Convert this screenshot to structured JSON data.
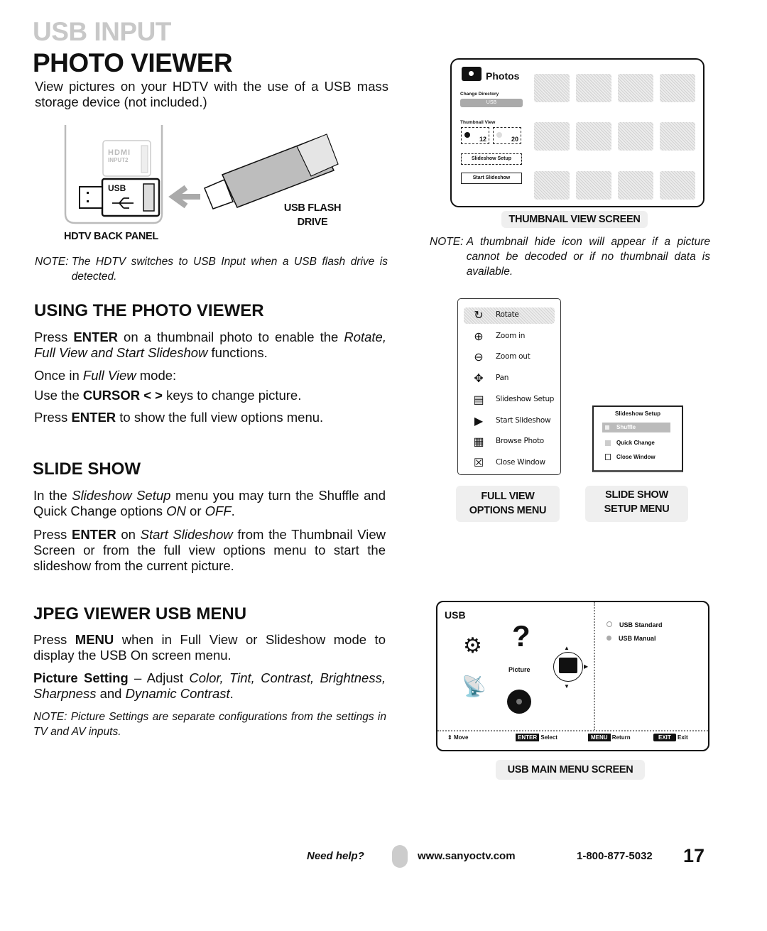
{
  "header": {
    "section_label": "USB INPUT",
    "page_title": "PHOTO VIEWER",
    "intro": "View pictures on your HDTV with the use of a USB mass storage device (not included.)"
  },
  "back_panel_figure": {
    "hdmi_label": "HDMI",
    "hdmi_input": "INPUT2",
    "usb_port_label": "USB",
    "panel_caption": "HDTV BACK PANEL",
    "drive_caption_line1": "USB FLASH",
    "drive_caption_line2": "DRIVE"
  },
  "note_detect": {
    "label": "NOTE",
    "text": "The HDTV switches to USB Input when a USB flash drive is detected."
  },
  "using": {
    "heading": "USING THE PHOTO VIEWER",
    "p1_a": "Press ",
    "p1_b": "ENTER",
    "p1_c": " on a thumbnail photo to enable the ",
    "p1_d": "Rotate, Full View and Start Slideshow",
    "p1_e": " functions.",
    "p2_a": "Once in ",
    "p2_b": "Full View",
    "p2_c": " mode:",
    "p3_a": "Use the ",
    "p3_b": "CURSOR < >",
    "p3_c": " keys to change picture.",
    "p4_a": "Press ",
    "p4_b": "ENTER",
    "p4_c": " to show the full view options menu."
  },
  "slideshow": {
    "heading": "SLIDE SHOW",
    "p1_a": "In the ",
    "p1_b": "Slideshow Setup",
    "p1_c": " menu you may turn the Shuffle and Quick Change options ",
    "p1_d": "ON",
    "p1_e": " or ",
    "p1_f": "OFF",
    "p1_g": ".",
    "p2_a": "Press ",
    "p2_b": "ENTER",
    "p2_c": " on ",
    "p2_d": "Start Slideshow",
    "p2_e": " from the Thumbnail View Screen or from the full view options menu to start the slideshow from the current picture."
  },
  "jpeg": {
    "heading": "JPEG VIEWER USB MENU",
    "p1_a": "Press ",
    "p1_b": "MENU",
    "p1_c": " when in Full View or Slideshow mode to display the USB On screen menu.",
    "p2_a": "Picture Setting",
    "p2_b": " – Adjust ",
    "p2_c": "Color, Tint, Contrast, Brightness, Sharpness",
    "p2_d": " and ",
    "p2_e": "Dynamic Contrast",
    "p2_f": ".",
    "note_label": "NOTE",
    "note_text": "Picture Settings are separate configurations from the settings in TV and AV inputs."
  },
  "thumbnail_screen": {
    "title": "Photos",
    "change_directory": "Change Directory",
    "directory_value": "USB",
    "thumbnail_view": "Thumbnail View",
    "view_12": "12",
    "view_20": "20",
    "slideshow_setup": "Slideshow Setup",
    "start_slideshow": "Start Slideshow",
    "caption": "THUMBNAIL VIEW SCREEN"
  },
  "note_thumb": {
    "label": "NOTE",
    "text": "A thumbnail hide icon will appear if a picture cannot be decoded or if no thumbnail data is available."
  },
  "fullview_menu": {
    "items": [
      {
        "icon": "rotate-icon",
        "label": "Rotate"
      },
      {
        "icon": "zoom-in-icon",
        "label": "Zoom in"
      },
      {
        "icon": "zoom-out-icon",
        "label": "Zoom out"
      },
      {
        "icon": "pan-icon",
        "label": "Pan"
      },
      {
        "icon": "slideshow-setup-icon",
        "label": "Slideshow Setup"
      },
      {
        "icon": "start-slideshow-icon",
        "label": "Start Slideshow"
      },
      {
        "icon": "browse-grid-icon",
        "label": "Browse Photo"
      },
      {
        "icon": "close-window-icon",
        "label": "Close Window"
      }
    ],
    "caption_line1": "FULL VIEW",
    "caption_line2": "OPTIONS MENU"
  },
  "slideshow_setup_menu": {
    "title": "Slideshow Setup",
    "items": [
      "Shuffle",
      "Quick Change",
      "Close Window"
    ],
    "caption_line1": "SLIDE SHOW",
    "caption_line2": "SETUP MENU"
  },
  "usb_main_screen": {
    "title": "USB",
    "selected_label": "Picture",
    "options": [
      "USB Standard",
      "USB Manual"
    ],
    "footer": {
      "move": "Move",
      "enter_key": "ENTER",
      "select": "Select",
      "menu_key": "MENU",
      "return": "Return",
      "exit_key": "EXIT",
      "exit": "Exit"
    },
    "caption": "USB MAIN MENU SCREEN"
  },
  "footer": {
    "need_help": "Need help?",
    "website": "www.sanyoctv.com",
    "phone": "1-800-877-5032",
    "page_number": "17"
  }
}
